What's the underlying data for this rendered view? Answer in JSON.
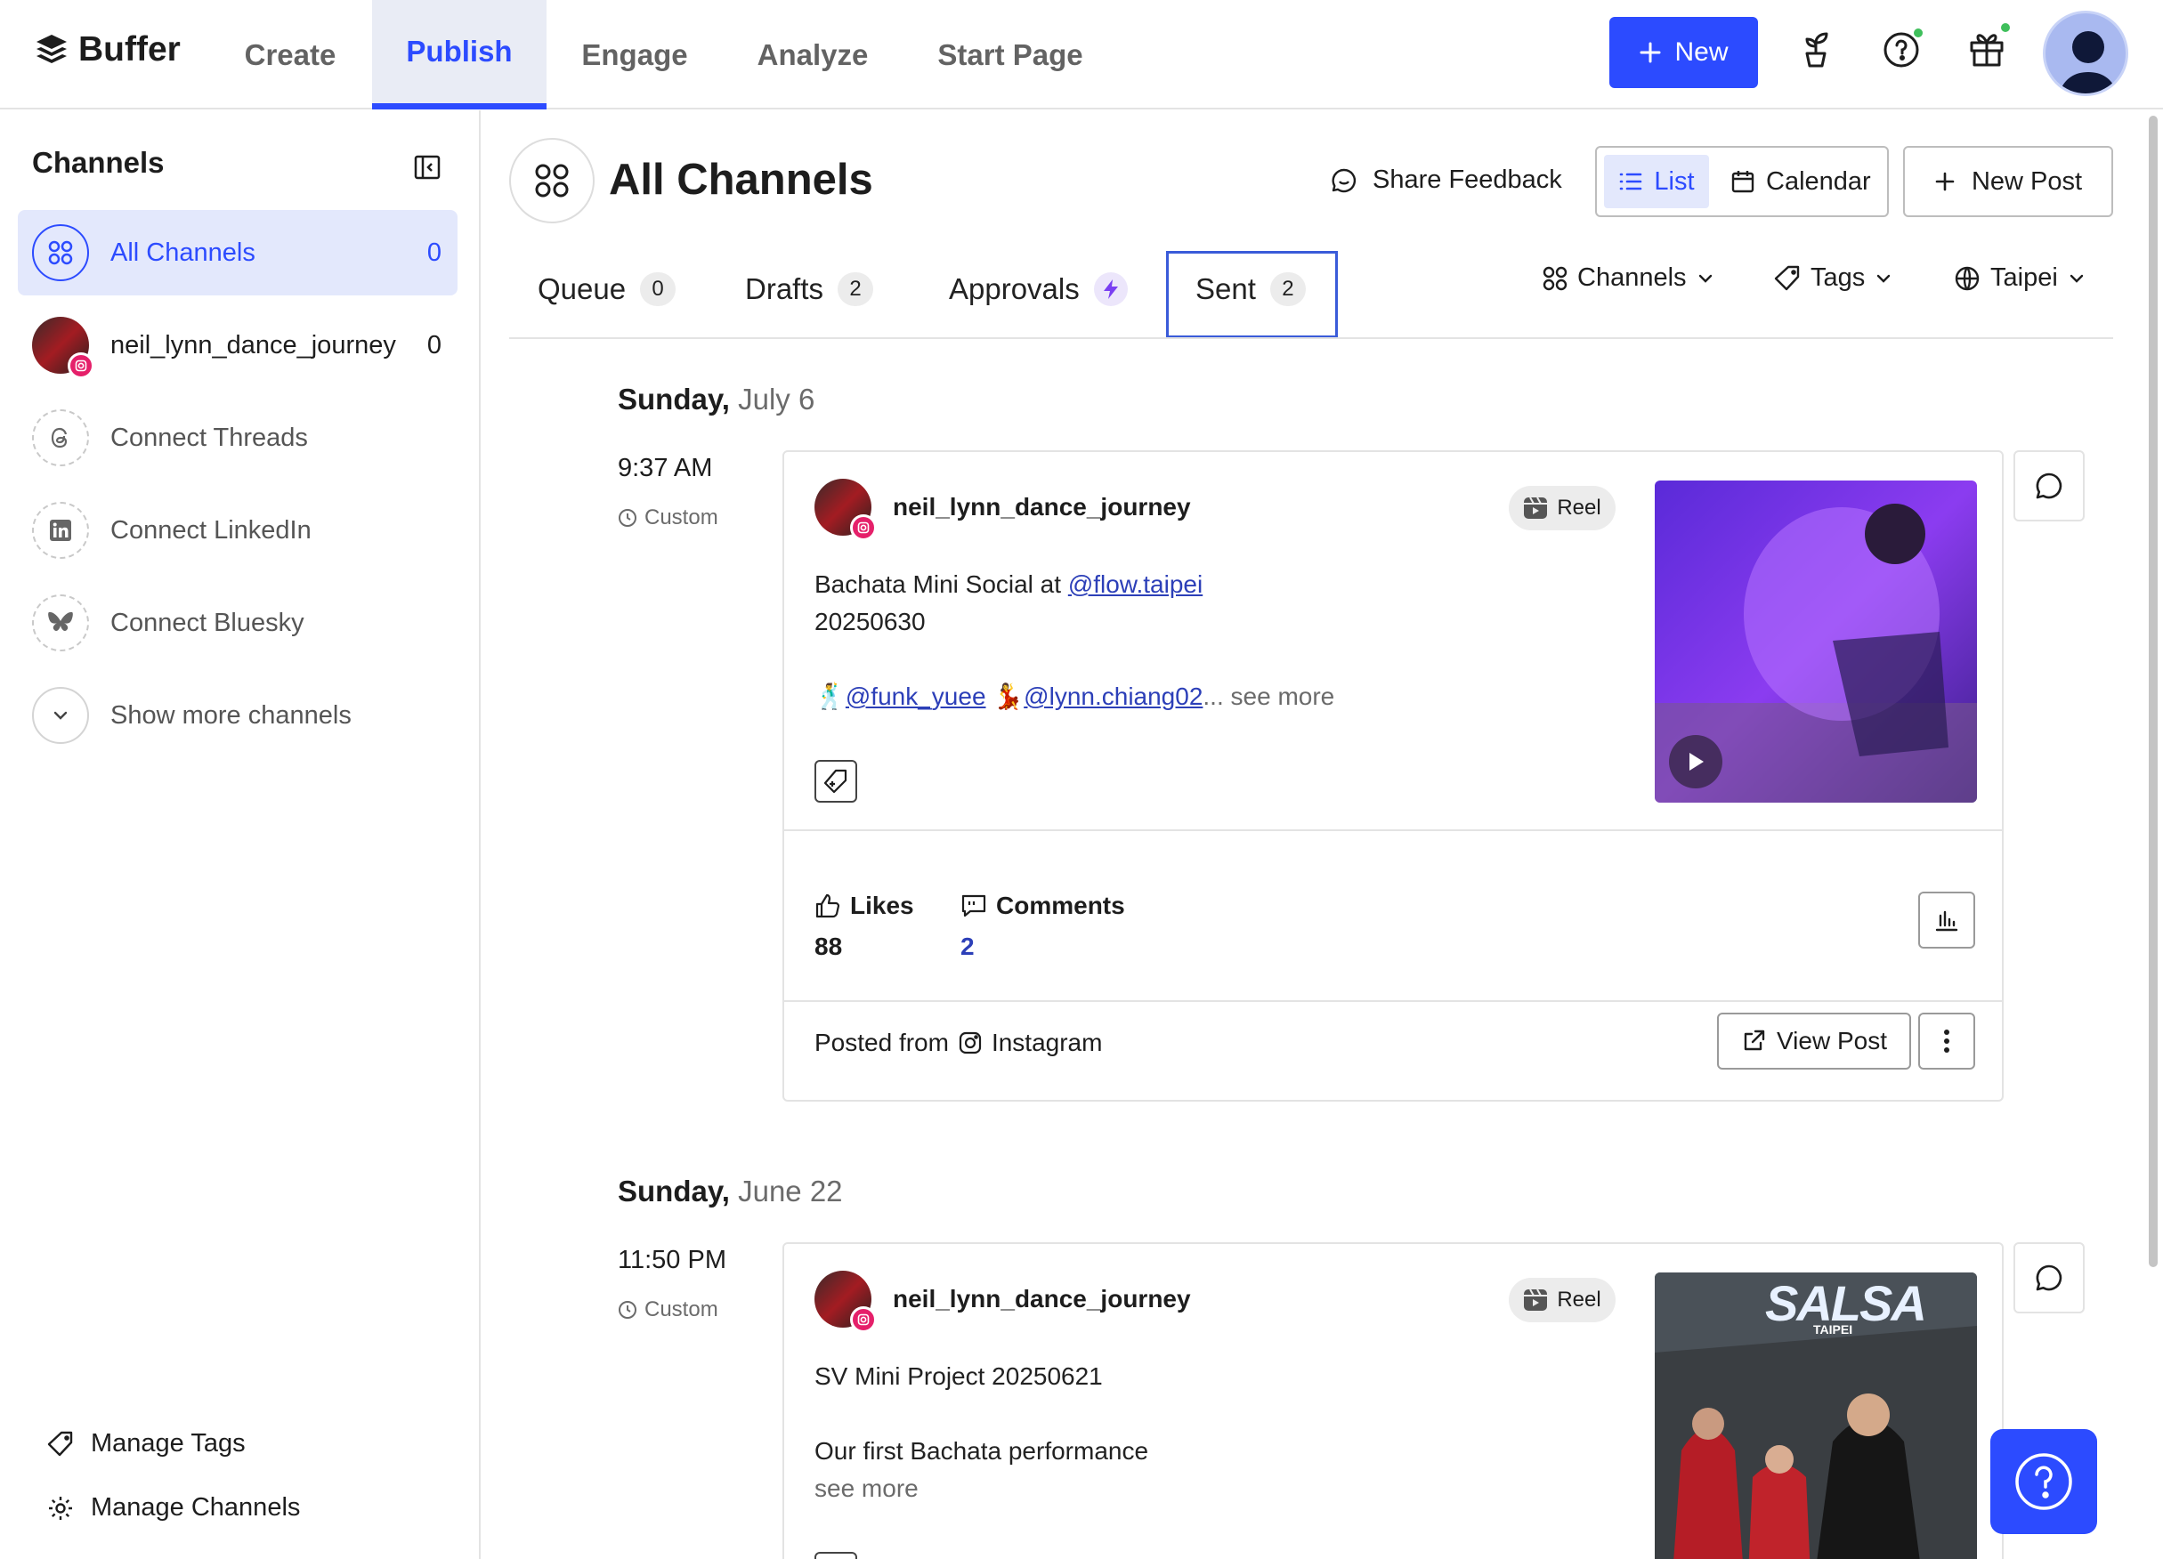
{
  "app": {
    "name": "Buffer"
  },
  "nav": {
    "items": [
      {
        "label": "Create"
      },
      {
        "label": "Publish"
      },
      {
        "label": "Engage"
      },
      {
        "label": "Analyze"
      },
      {
        "label": "Start Page"
      }
    ],
    "active": "Publish",
    "new_label": "New"
  },
  "sidebar": {
    "title": "Channels",
    "channels": [
      {
        "label": "All Channels",
        "count": "0"
      },
      {
        "label": "neil_lynn_dance_journey",
        "count": "0"
      },
      {
        "label": "Connect Threads"
      },
      {
        "label": "Connect LinkedIn"
      },
      {
        "label": "Connect Bluesky"
      },
      {
        "label": "Show more channels"
      }
    ],
    "manage_tags": "Manage Tags",
    "manage_channels": "Manage Channels"
  },
  "main": {
    "title": "All Channels",
    "share_feedback": "Share Feedback",
    "view_list": "List",
    "view_calendar": "Calendar",
    "new_post": "New Post",
    "tabs": [
      {
        "label": "Queue",
        "count": "0"
      },
      {
        "label": "Drafts",
        "count": "2"
      },
      {
        "label": "Approvals"
      },
      {
        "label": "Sent",
        "count": "2"
      }
    ],
    "filters": {
      "channels": "Channels",
      "tags": "Tags",
      "timezone": "Taipei"
    }
  },
  "posts": [
    {
      "date_day": "Sunday,",
      "date_rest": "July 6",
      "time": "9:37 AM",
      "schedule": "Custom",
      "user": "neil_lynn_dance_journey",
      "type": "Reel",
      "line1_prefix": "Bachata Mini Social at ",
      "line1_link": "@flow.taipei",
      "line2": "20250630",
      "mention1": "@funk_yuee",
      "mention2": "@lynn.chiang02",
      "ellipsis": "...",
      "see_more": "see more",
      "likes_label": "Likes",
      "likes": "88",
      "comments_label": "Comments",
      "comments": "2",
      "posted_from_label": "Posted from",
      "posted_from": "Instagram",
      "view_post": "View Post"
    },
    {
      "date_day": "Sunday,",
      "date_rest": "June 22",
      "time": "11:50 PM",
      "schedule": "Custom",
      "user": "neil_lynn_dance_journey",
      "type": "Reel",
      "line1": "SV Mini Project 20250621",
      "line2": "Our first Bachata performance",
      "see_more": "see more",
      "thumb_title": "SALSA",
      "thumb_sub": "TAIPEI"
    }
  ],
  "colors": {
    "accent": "#2c4bff",
    "instagram": "#e5206a",
    "online": "#3fbf5b"
  }
}
